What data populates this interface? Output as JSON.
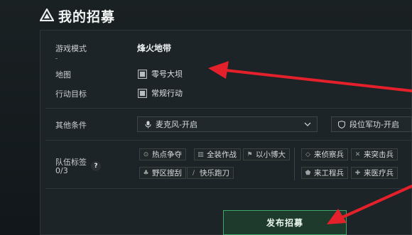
{
  "header": {
    "title": "我的招募"
  },
  "form": {
    "mode_label": "游戏模式",
    "mode_value": "烽火地带",
    "map_label": "地图",
    "map_option": "零号大坝",
    "goal_label": "行动目标",
    "goal_option": "常规行动",
    "other_label": "其他条件",
    "mic_select": "麦克风-开启",
    "rank_select": "段位军功-开启",
    "tags_label": "队伍标签",
    "tags_count": "0/3",
    "help_glyph": "?"
  },
  "tags": {
    "group1": [
      "热点争夺",
      "全装作战",
      "以小博大",
      "野区搜刮",
      "快乐跑刀"
    ],
    "group2": [
      "来侦察兵",
      "来突击兵",
      "来工程兵",
      "来医疗兵"
    ]
  },
  "actions": {
    "publish_label": "发布招募"
  },
  "colors": {
    "accent_green": "#3ea86a",
    "arrow_red": "#e4202a"
  }
}
